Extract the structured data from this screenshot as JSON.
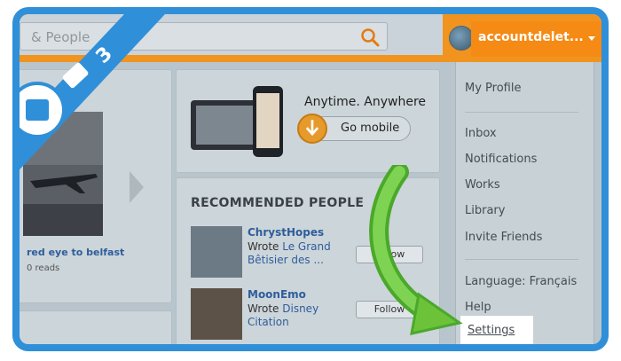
{
  "header": {
    "search_text": "& People",
    "account_name": "accountdelet...",
    "icons": [
      "search-icon",
      "avatar",
      "chevron-down-icon"
    ]
  },
  "left_panel": {
    "book_title": "red eye to belfast",
    "book_reads": "0 reads"
  },
  "mobile_promo": {
    "headline": "Anytime. Anywhere",
    "button_label": "Go mobile"
  },
  "recommended": {
    "heading": "RECOMMENDED PEOPLE",
    "people": [
      {
        "name": "ChrystHopes",
        "wrote_prefix": "Wrote ",
        "work": "Le Grand Bêtisier des ...",
        "button": "Follow"
      },
      {
        "name": "MoonEmo",
        "wrote_prefix": "Wrote ",
        "work": "Disney Citation",
        "button": "Follow"
      }
    ]
  },
  "dropdown_menu": {
    "items": [
      {
        "label": "My Profile"
      },
      {
        "label": "Inbox"
      },
      {
        "label": "Notifications"
      },
      {
        "label": "Works"
      },
      {
        "label": "Library"
      },
      {
        "label": "Invite Friends"
      },
      {
        "label": "Language: Français"
      },
      {
        "label": "Help"
      },
      {
        "label": "Settings"
      }
    ]
  },
  "step_badge": {
    "step": "3"
  },
  "colors": {
    "frame": "#2f8fd8",
    "topbar": "#f0941f",
    "link": "#2f5d9a",
    "arrow": "#6cc33a"
  }
}
